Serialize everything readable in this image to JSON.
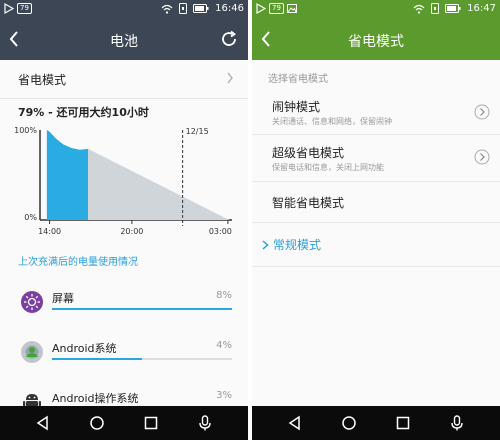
{
  "left": {
    "status": {
      "badge": "79",
      "time": "16:46"
    },
    "title": "电池",
    "power_mode_label": "省电模式",
    "battery_summary": "79% - 还可用大约10小时",
    "chart_data": {
      "type": "area",
      "x_tick_labels": [
        "14:00",
        "20:00",
        "03:00"
      ],
      "y_tick_labels": [
        "100%",
        "0%"
      ],
      "marker_label": "12/15",
      "ylim": [
        0,
        100
      ],
      "series": [
        {
          "points": [
            [
              13.8,
              100
            ],
            [
              14.0,
              98
            ],
            [
              14.5,
              90
            ],
            [
              15.0,
              84
            ],
            [
              15.6,
              80
            ],
            [
              16.2,
              78
            ],
            [
              16.8,
              79
            ]
          ]
        },
        {
          "points": [
            [
              16.8,
              79
            ],
            [
              27.1,
              0
            ]
          ]
        }
      ],
      "xlim": [
        13.3,
        27.3
      ],
      "marker_x": 23.7,
      "colors": {
        "used": "#2aace2",
        "projected": "#cfd5d9"
      }
    },
    "usage_header": "上次充满后的电量使用情况",
    "usage": [
      {
        "name": "屏幕",
        "percent": "8%",
        "fill": 1.0,
        "icon": "brightness-icon"
      },
      {
        "name": "Android系统",
        "percent": "4%",
        "fill": 0.5,
        "icon": "android-system-icon"
      },
      {
        "name": "Android操作系统",
        "percent": "3%",
        "fill": 0.38,
        "icon": "android-os-icon"
      }
    ]
  },
  "right": {
    "status": {
      "badge": "79",
      "time": "16:47"
    },
    "title": "省电模式",
    "section_label": "选择省电模式",
    "modes": [
      {
        "title": "闹钟模式",
        "desc": "关闭通话、信息和网络，保留闹钟",
        "has_chevron": true
      },
      {
        "title": "超级省电模式",
        "desc": "保留电话和信息，关闭上网功能",
        "has_chevron": true
      },
      {
        "title": "智能省电模式",
        "desc": "",
        "has_chevron": false
      }
    ],
    "normal_mode": "常规模式"
  }
}
